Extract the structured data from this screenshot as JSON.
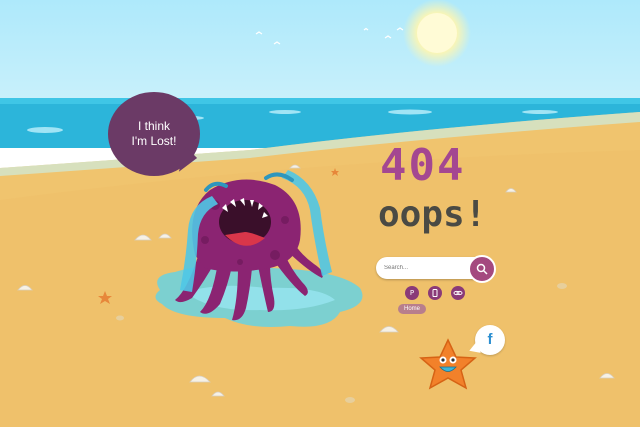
{
  "speech": {
    "line1": "I think",
    "line2": "I'm Lost!"
  },
  "error": {
    "code": "404",
    "message": "oops!"
  },
  "search": {
    "placeholder": "Search..."
  },
  "nav": {
    "home_label": "Home"
  },
  "social": {
    "facebook_label": "f"
  },
  "colors": {
    "sky": "#aee9fb",
    "sea": "#2cb5da",
    "sand": "#f0c46e",
    "accent": "#a4497f",
    "monster": "#8b2472"
  }
}
